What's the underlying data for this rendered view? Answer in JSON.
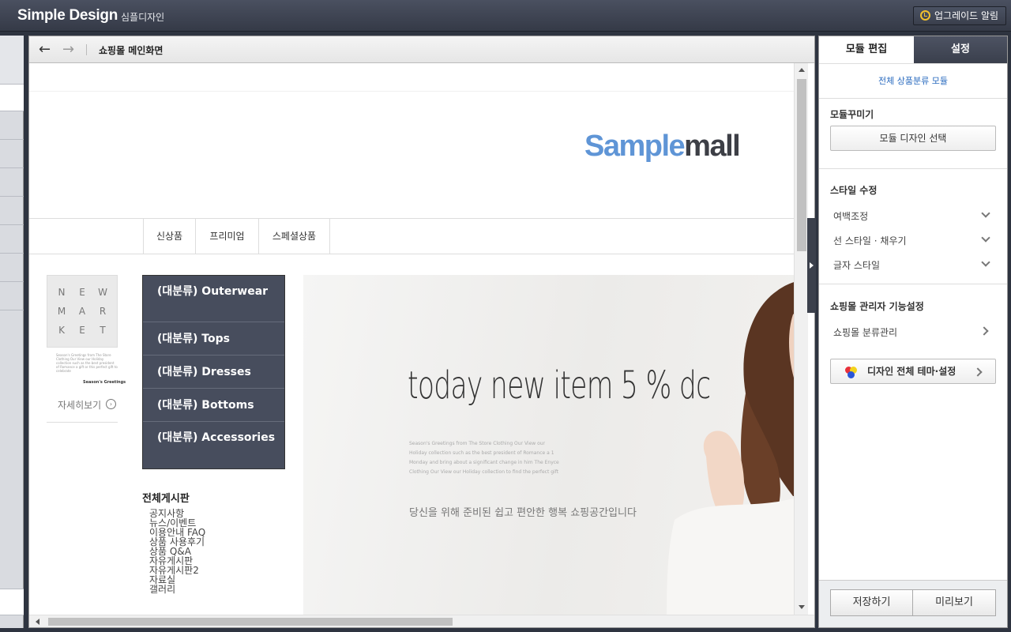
{
  "app": {
    "name": "Simple Design",
    "subtitle": "심플디자인",
    "upgrade_label": "업그레이드 알림"
  },
  "center": {
    "title": "쇼핑몰 메인화면",
    "back_icon": "←",
    "forward_icon": "→"
  },
  "site": {
    "logo_part1": "Sample",
    "logo_part2": "mall",
    "gnb": [
      "신상품",
      "프리미엄",
      "스페셜상품"
    ],
    "newmarket_letters": [
      "N",
      "E",
      "W",
      "M",
      "A",
      "R",
      "K",
      "E",
      "T"
    ],
    "newmarket_text": "Season's Greetings from The Store Clothing Our View our Holiday collection such as the best president of Romance a gift or this perfect gift to celebrate",
    "newmarket_signature": "Season's Greetings",
    "more_label": "자세히보기",
    "categories": [
      "(대분류) Outerwear",
      "(대분류) Tops",
      "(대분류) Dresses",
      "(대분류) Bottoms",
      "(대분류) Accessories"
    ],
    "board_title": "전체게시판",
    "board_items": [
      "공지사항",
      "뉴스/이벤트",
      "이용안내 FAQ",
      "상품 사용후기",
      "상품 Q&A",
      "자유게시판",
      "자유게시판2",
      "자료실",
      "갤러리"
    ],
    "hero_headline": "today new item 5 % dc",
    "hero_small": "Season's Greetings from The Store Clothing Our View our Holiday collection such as the best president of Romance a 1 Monday and bring about a significant change in him The Enyce Clothing Our View our Holiday collection to find the perfect gift",
    "hero_korean": "당신을 위해 준비된 쉽고 편안한 행복 쇼핑공간입니다"
  },
  "panel": {
    "tabs": [
      "모듈 편집",
      "설정"
    ],
    "crumb": "전체 상품분류 모듈",
    "decorate_title": "모듈꾸미기",
    "design_select": "모듈 디자인 선택",
    "style_title": "스타일 수정",
    "style_options": [
      "여백조정",
      "선 스타일 · 채우기",
      "글자 스타일"
    ],
    "admin_title": "쇼핑몰 관리자 기능설정",
    "admin_item": "쇼핑몰 분류관리",
    "theme_button": "디자인 전체 테마·설정",
    "save": "저장하기",
    "preview": "미리보기"
  },
  "colors": {
    "accent_blue": "#5f95d6",
    "category_bg": "#474d5d",
    "topbar": "#3b404c"
  }
}
